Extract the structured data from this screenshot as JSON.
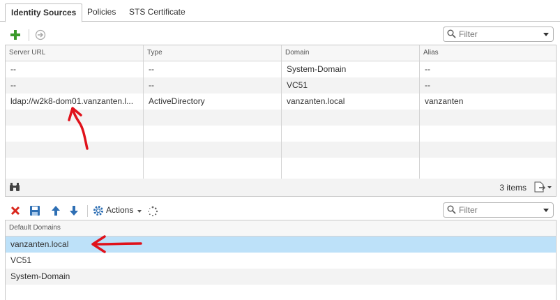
{
  "tabs": [
    {
      "label": "Identity Sources",
      "active": true
    },
    {
      "label": "Policies",
      "active": false
    },
    {
      "label": "STS Certificate",
      "active": false
    }
  ],
  "identity_sources": {
    "filter_placeholder": "Filter",
    "columns": [
      "Server URL",
      "Type",
      "Domain",
      "Alias"
    ],
    "rows": [
      [
        "--",
        "--",
        "System-Domain",
        "--"
      ],
      [
        "--",
        "--",
        "VC51",
        "--"
      ],
      [
        "ldap://w2k8-dom01.vanzanten.l...",
        "ActiveDirectory",
        "vanzanten.local",
        "vanzanten"
      ]
    ],
    "item_count": "3 items"
  },
  "default_domains": {
    "actions_label": "Actions",
    "filter_placeholder": "Filter",
    "column": "Default Domains",
    "rows": [
      "vanzanten.local",
      "VC51",
      "System-Domain"
    ],
    "selected_index": 0
  },
  "colors": {
    "selection": "#bde1f9",
    "annotation_arrow": "#e0121b",
    "add_icon": "#3a9a2a",
    "delete_icon": "#d9261c",
    "save_icon": "#2e6fb4"
  }
}
